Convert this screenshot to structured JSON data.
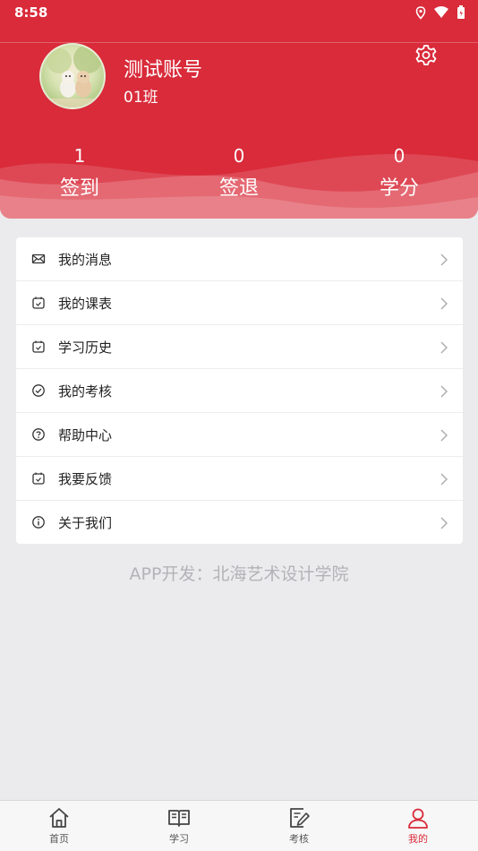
{
  "status": {
    "time": "8:58"
  },
  "profile": {
    "name": "测试账号",
    "class": "01班"
  },
  "stats": [
    {
      "value": "1",
      "label": "签到"
    },
    {
      "value": "0",
      "label": "签退"
    },
    {
      "value": "0",
      "label": "学分"
    }
  ],
  "menu": [
    {
      "label": "我的消息",
      "icon": "mail-icon"
    },
    {
      "label": "我的课表",
      "icon": "schedule-icon"
    },
    {
      "label": "学习历史",
      "icon": "history-icon"
    },
    {
      "label": "我的考核",
      "icon": "check-circle-icon"
    },
    {
      "label": "帮助中心",
      "icon": "help-icon"
    },
    {
      "label": "我要反馈",
      "icon": "feedback-icon"
    },
    {
      "label": "关于我们",
      "icon": "info-icon"
    }
  ],
  "footer": {
    "text": "APP开发：北海艺术设计学院"
  },
  "tabs": [
    {
      "label": "首页",
      "icon": "home-icon"
    },
    {
      "label": "学习",
      "icon": "book-icon"
    },
    {
      "label": "考核",
      "icon": "exam-icon"
    },
    {
      "label": "我的",
      "icon": "user-icon"
    }
  ],
  "colors": {
    "accent": "#d92b3a",
    "background": "#ebebed"
  }
}
